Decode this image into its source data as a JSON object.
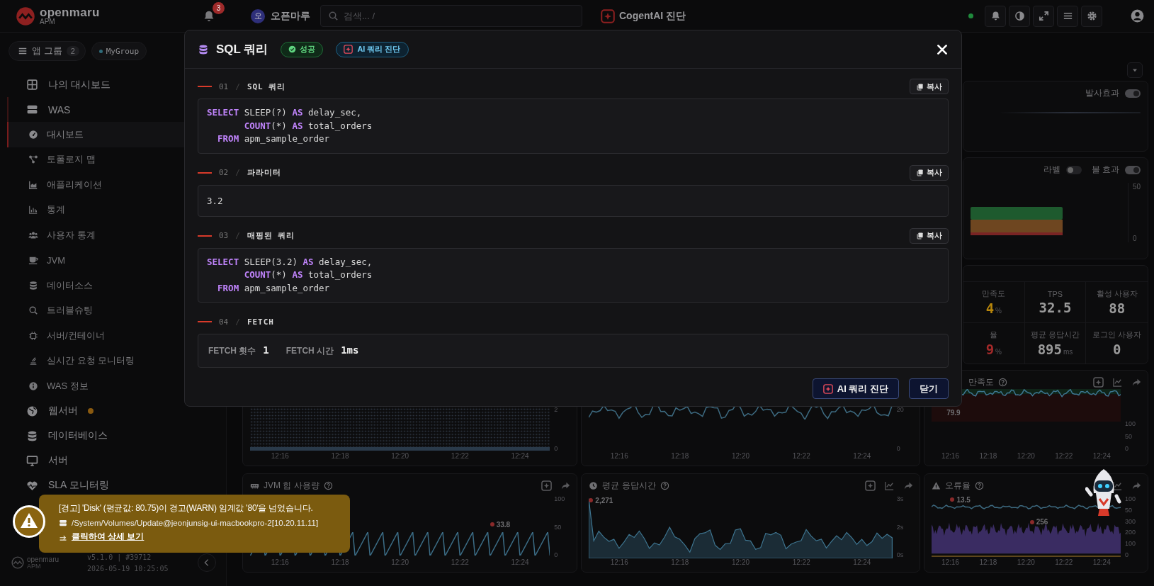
{
  "topbar": {
    "logo": {
      "name": "openmaru",
      "sub": "APM"
    },
    "notifications": {
      "count": "3"
    },
    "org": {
      "initial": "오",
      "name": "오픈마루"
    },
    "search": {
      "placeholder": "검색... /"
    },
    "ai_link": {
      "label": "CogentAI 진단"
    }
  },
  "sidebar": {
    "app_group": {
      "label": "앱 그룹",
      "count": "2",
      "chip": "MyGroup"
    },
    "items": [
      {
        "label": "나의 대시보드",
        "expanded": false,
        "alert": false
      },
      {
        "label": "WAS",
        "expanded": true,
        "alert": false,
        "children": [
          {
            "label": "대시보드",
            "selected": true
          },
          {
            "label": "토폴로지 맵",
            "selected": false
          },
          {
            "label": "애플리케이션",
            "selected": false
          },
          {
            "label": "통계",
            "selected": false
          },
          {
            "label": "사용자 통계",
            "selected": false
          },
          {
            "label": "JVM",
            "selected": false
          },
          {
            "label": "데이터소스",
            "selected": false
          },
          {
            "label": "트러블슈팅",
            "selected": false
          },
          {
            "label": "서버/컨테이너",
            "selected": false
          },
          {
            "label": "실시간 요청 모니터링",
            "selected": false
          },
          {
            "label": "WAS 정보",
            "selected": false
          }
        ]
      },
      {
        "label": "웹서버",
        "expanded": false,
        "alert": true
      },
      {
        "label": "데이터베이스",
        "expanded": false,
        "alert": false
      },
      {
        "label": "서버",
        "expanded": false,
        "alert": false
      },
      {
        "label": "SLA 모니터링",
        "expanded": false,
        "alert": false
      }
    ],
    "footer": {
      "logo": "openmaru",
      "logo_sub": "APM",
      "version": "v5.1.0 | #39712",
      "timestamp": "2026-05-19 10:25:05"
    }
  },
  "dashboard": {
    "panels": [
      {
        "kind": "effect",
        "toggles": [
          {
            "label": "발사효과",
            "on": true
          }
        ]
      },
      {
        "kind": "bars",
        "toggles": [
          {
            "label": "라벨",
            "on": false
          },
          {
            "label": "볼 효과",
            "on": true
          }
        ],
        "y_labels": [
          "50",
          "0"
        ]
      },
      {
        "kind": "kpi",
        "metrics": [
          {
            "label": "만족도",
            "value": "4",
            "unit": "%",
            "color": "#b8860b"
          },
          {
            "label": "TPS",
            "value": "32.5",
            "color": "#9a9a9a"
          },
          {
            "label": "활성 사용자",
            "value": "88",
            "color": "#9a9a9a"
          },
          {
            "label": "율",
            "value": "9",
            "unit": "%",
            "color": "#a52a2a"
          },
          {
            "label": "평균 응답시간",
            "value": "895",
            "unit": "ms",
            "color": "#9a9a9a"
          },
          {
            "label": "로그인 사용자",
            "value": "0",
            "color": "#9a9a9a"
          }
        ]
      }
    ],
    "charts": [
      {
        "kind": "dots",
        "y_labels": [
          "2",
          "0"
        ],
        "x_labels": [
          "12:16",
          "12:18",
          "12:20",
          "12:22",
          "12:24"
        ]
      },
      {
        "kind": "line",
        "y_labels": [
          "20",
          "0"
        ],
        "x_labels": [
          "12:16",
          "12:18",
          "12:20",
          "12:22",
          "12:24"
        ]
      },
      {
        "kind": "band",
        "title": "만족도",
        "y_labels": [
          "100",
          "50",
          "0"
        ],
        "callouts": [
          "79.9"
        ],
        "x_labels": [
          "12:16",
          "12:18",
          "12:20",
          "12:22",
          "12:24"
        ]
      },
      {
        "kind": "sawtooth",
        "title": "JVM 힙 사용량",
        "y_labels": [
          "100",
          "50",
          "0"
        ],
        "callouts": [
          "33.8"
        ],
        "x_labels": [
          "12:16",
          "12:18",
          "12:20",
          "12:22",
          "12:24"
        ]
      },
      {
        "kind": "area",
        "title": "평균 응답시간",
        "y_labels": [
          "3s",
          "2s",
          "0s"
        ],
        "callouts": [
          "2,271"
        ],
        "x_labels": [
          "12:16",
          "12:18",
          "12:20",
          "12:22",
          "12:24"
        ]
      },
      {
        "kind": "dual",
        "title": "오류율",
        "y_labels": [
          "100",
          "50",
          "300",
          "200",
          "100",
          "0"
        ],
        "callouts": [
          "13.5",
          "256"
        ],
        "x_labels": [
          "12:16",
          "12:18",
          "12:20",
          "12:22",
          "12:24"
        ]
      }
    ]
  },
  "modal": {
    "title": "SQL 쿼리",
    "status": "성공",
    "ai_badge": "AI 쿼리 진단",
    "sections": [
      {
        "kind": "code",
        "number": "01",
        "separator": "/",
        "title": "SQL 쿼리",
        "copy": "복사",
        "lines": [
          [
            {
              "text": "SELECT",
              "kind": "keyword"
            },
            {
              "text": " SLEEP(?) ",
              "kind": "plain"
            },
            {
              "text": "AS",
              "kind": "keyword"
            },
            {
              "text": " delay_sec,",
              "kind": "plain"
            }
          ],
          [
            {
              "text": "       COUNT",
              "kind": "keyword"
            },
            {
              "text": "(*) ",
              "kind": "plain"
            },
            {
              "text": "AS",
              "kind": "keyword"
            },
            {
              "text": " total_orders",
              "kind": "plain"
            }
          ],
          [
            {
              "text": "  FROM",
              "kind": "keyword"
            },
            {
              "text": " apm_sample_order",
              "kind": "plain"
            }
          ]
        ]
      },
      {
        "kind": "text",
        "number": "02",
        "separator": "/",
        "title": "파라미터",
        "copy": "복사",
        "value": "3.2"
      },
      {
        "kind": "code",
        "number": "03",
        "separator": "/",
        "title": "매핑된 쿼리",
        "copy": "복사",
        "lines": [
          [
            {
              "text": "SELECT",
              "kind": "keyword"
            },
            {
              "text": " SLEEP(3.2) ",
              "kind": "plain"
            },
            {
              "text": "AS",
              "kind": "keyword"
            },
            {
              "text": " delay_sec,",
              "kind": "plain"
            }
          ],
          [
            {
              "text": "       COUNT",
              "kind": "keyword"
            },
            {
              "text": "(*) ",
              "kind": "plain"
            },
            {
              "text": "AS",
              "kind": "keyword"
            },
            {
              "text": " total_orders",
              "kind": "plain"
            }
          ],
          [
            {
              "text": "  FROM",
              "kind": "keyword"
            },
            {
              "text": " apm_sample_order",
              "kind": "plain"
            }
          ]
        ]
      },
      {
        "kind": "fetch",
        "number": "04",
        "separator": "/",
        "title": "FETCH",
        "stats": [
          {
            "label": "FETCH 횟수",
            "value": "1"
          },
          {
            "label": "FETCH 시간",
            "value": "1ms"
          }
        ]
      }
    ],
    "buttons": [
      {
        "label": "AI 쿼리 진단",
        "kind": "ai"
      },
      {
        "label": "닫기",
        "kind": "plain"
      }
    ]
  },
  "toast": {
    "title": "[경고] 'Disk' (평균값: 80.75)이 경고(WARN) 임계값 '80'을 넘었습니다.",
    "source": "/System/Volumes/Update@jeonjunsig-ui-macbookpro-2[10.20.11.11]",
    "link": "클릭하여 상세 보기"
  }
}
